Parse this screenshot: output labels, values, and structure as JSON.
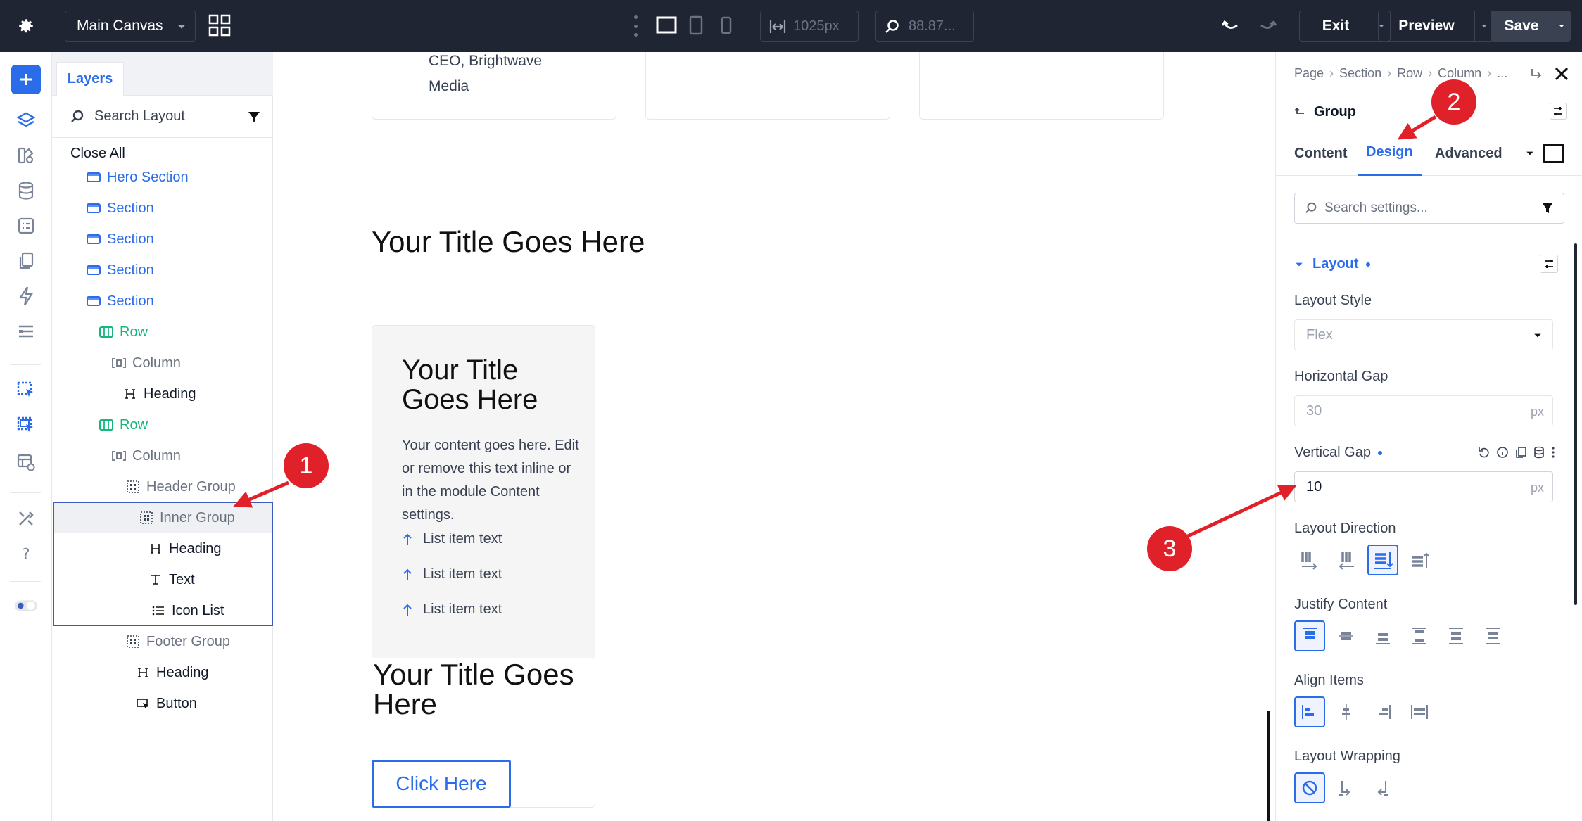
{
  "topbar": {
    "canvas_select": "Main Canvas",
    "width_value": "1025px",
    "zoom_value": "88.87...",
    "exit_label": "Exit",
    "preview_label": "Preview",
    "save_label": "Save"
  },
  "layers": {
    "tab_label": "Layers",
    "search_placeholder": "Search Layout",
    "close_all": "Close All",
    "items": [
      {
        "label": "Hero Section",
        "type": "section"
      },
      {
        "label": "Section",
        "type": "section"
      },
      {
        "label": "Section",
        "type": "section"
      },
      {
        "label": "Section",
        "type": "section"
      },
      {
        "label": "Section",
        "type": "section"
      },
      {
        "label": "Row",
        "type": "row"
      },
      {
        "label": "Column",
        "type": "column"
      },
      {
        "label": "Heading",
        "type": "heading"
      },
      {
        "label": "Row",
        "type": "row"
      },
      {
        "label": "Column",
        "type": "column"
      },
      {
        "label": "Header Group",
        "type": "group"
      },
      {
        "label": "Inner Group",
        "type": "group"
      },
      {
        "label": "Heading",
        "type": "heading"
      },
      {
        "label": "Text",
        "type": "text"
      },
      {
        "label": "Icon List",
        "type": "list"
      },
      {
        "label": "Footer Group",
        "type": "group"
      },
      {
        "label": "Heading",
        "type": "heading"
      },
      {
        "label": "Button",
        "type": "button"
      }
    ]
  },
  "canvas": {
    "top_card_caption_line1": "CEO, Brightwave",
    "top_card_caption_line2": "Media",
    "section_title": "Your Title Goes Here",
    "inner_title": "Your Title Goes Here",
    "inner_text": "Your content goes here. Edit or remove this text inline or in the module Content settings.",
    "list_items": [
      "List item text",
      "List item text",
      "List item text"
    ],
    "footer_title": "Your Title Goes Here",
    "button_label": "Click Here"
  },
  "settings": {
    "breadcrumb": [
      "Page",
      "Section",
      "Row",
      "Column",
      "..."
    ],
    "group_title": "Group",
    "tabs": [
      "Content",
      "Design",
      "Advanced"
    ],
    "active_tab": "Design",
    "search_placeholder": "Search settings...",
    "layout_header": "Layout",
    "layout_style_label": "Layout Style",
    "layout_style_value": "Flex",
    "horizontal_gap_label": "Horizontal Gap",
    "horizontal_gap_value": "30",
    "vertical_gap_label": "Vertical Gap",
    "vertical_gap_value": "10",
    "unit": "px",
    "layout_direction_label": "Layout Direction",
    "justify_content_label": "Justify Content",
    "align_items_label": "Align Items",
    "layout_wrapping_label": "Layout Wrapping"
  },
  "annotations": [
    "1",
    "2",
    "3"
  ],
  "colors": {
    "accent": "#2b6cea",
    "topbar": "#1f2533",
    "row_green": "#16b87a",
    "annotation_red": "#e0212a"
  }
}
